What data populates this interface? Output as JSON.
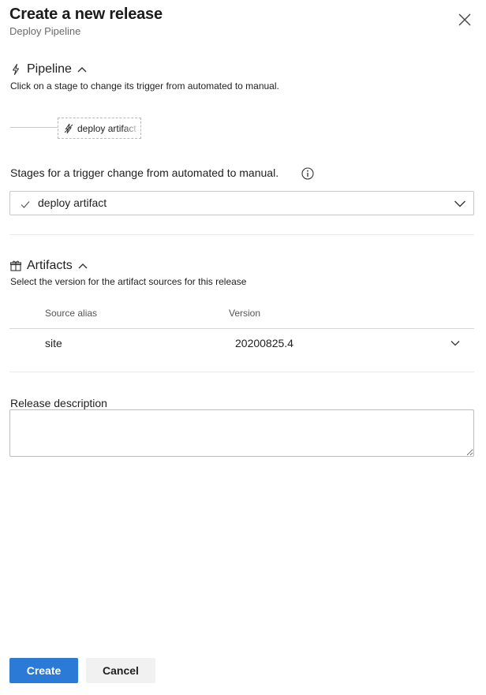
{
  "panel": {
    "title": "Create a new release",
    "subtitle": "Deploy Pipeline"
  },
  "pipeline": {
    "heading": "Pipeline",
    "description": "Click on a stage to change its trigger from automated to manual.",
    "stage_label": "deploy artifact",
    "stages_label": "Stages for a trigger change from automated to manual.",
    "selected_stage": "deploy artifact"
  },
  "artifacts": {
    "heading": "Artifacts",
    "description": "Select the version for the artifact sources for this release",
    "columns": [
      "Source alias",
      "Version"
    ],
    "rows": [
      {
        "alias": "site",
        "version": "20200825.4"
      }
    ]
  },
  "release_description": {
    "label": "Release description",
    "value": ""
  },
  "buttons": {
    "create": "Create",
    "cancel": "Cancel"
  },
  "colors": {
    "primary": "#2b7bd6"
  }
}
